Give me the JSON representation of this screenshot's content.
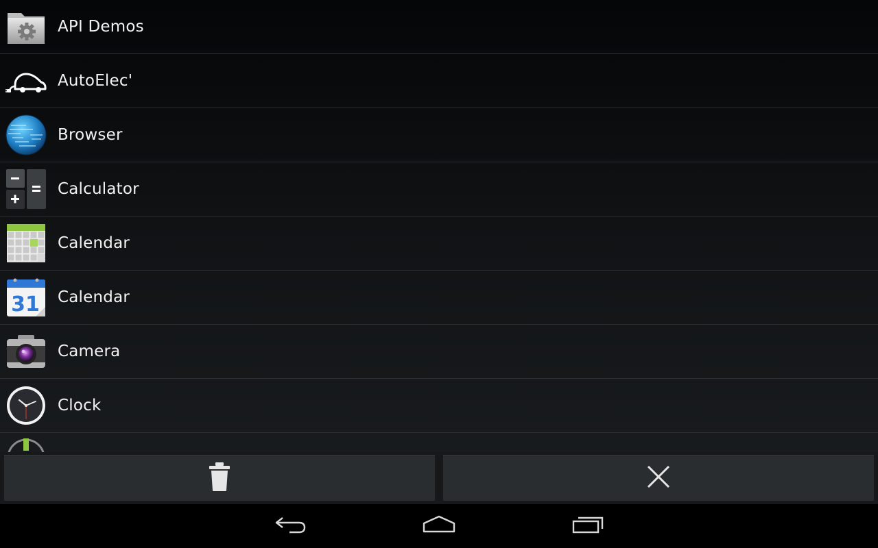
{
  "apps": [
    {
      "label": "API Demos",
      "icon": "folder-gear-icon"
    },
    {
      "label": "AutoElec'",
      "icon": "electric-car-icon"
    },
    {
      "label": "Browser",
      "icon": "globe-icon"
    },
    {
      "label": "Calculator",
      "icon": "calculator-icon"
    },
    {
      "label": "Calendar",
      "icon": "calendar-grid-icon"
    },
    {
      "label": "Calendar",
      "icon": "calendar-31-icon"
    },
    {
      "label": "Camera",
      "icon": "camera-icon"
    },
    {
      "label": "Clock",
      "icon": "clock-icon"
    }
  ],
  "calendar_icon_day": "31",
  "action_bar": {
    "delete_icon": "trash-icon",
    "close_icon": "close-icon"
  },
  "nav_bar": {
    "back_icon": "back-icon",
    "home_icon": "home-icon",
    "recents_icon": "recents-icon"
  },
  "colors": {
    "background": "#101214",
    "text": "#f2f2f2",
    "divider": "#2c3034",
    "action_button": "#2a2d30"
  }
}
